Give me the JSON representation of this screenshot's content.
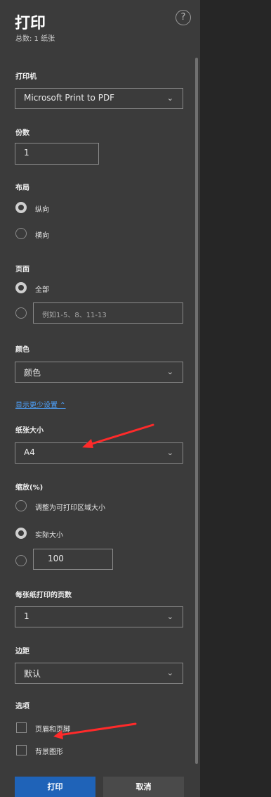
{
  "header": {
    "title": "打印",
    "subtitle": "总数: 1 纸张",
    "help_label": "?"
  },
  "printer": {
    "label": "打印机",
    "value": "Microsoft Print to PDF"
  },
  "copies": {
    "label": "份数",
    "value": "1"
  },
  "layout": {
    "label": "布局",
    "options": [
      "纵向",
      "横向"
    ],
    "selected": "纵向"
  },
  "pages": {
    "label": "页面",
    "options": [
      "全部"
    ],
    "placeholder": "例如1-5、8、11-13",
    "selected": "全部"
  },
  "color": {
    "label": "颜色",
    "value": "颜色"
  },
  "settings_link": "显示更少设置 ⌃",
  "paper_size": {
    "label": "纸张大小",
    "value": "A4"
  },
  "scale": {
    "label": "缩放(%)",
    "options": [
      "调整为可打印区域大小",
      "实际大小"
    ],
    "selected": "实际大小",
    "custom_value": "100"
  },
  "pages_per_sheet": {
    "label": "每张纸打印的页数",
    "value": "1"
  },
  "margins": {
    "label": "边距",
    "value": "默认"
  },
  "options": {
    "label": "选项",
    "items": [
      "页眉和页脚",
      "背景图形"
    ]
  },
  "actions": {
    "print_label": "打印",
    "cancel_label": "取消"
  },
  "colors": {
    "panel_bg": "#3b3b3b",
    "page_bg": "#262626",
    "accent": "#1f63b8",
    "link": "#4ea3ff",
    "annotation_arrow": "#ff2a2a"
  }
}
